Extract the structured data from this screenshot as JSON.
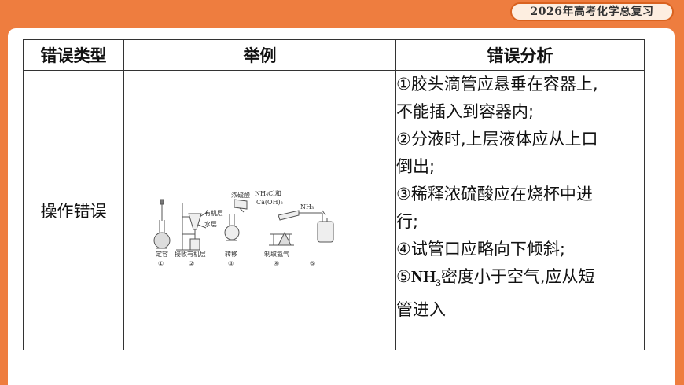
{
  "header": {
    "badge": "2026年高考化学总复习"
  },
  "table": {
    "headers": [
      "错误类型",
      "举例",
      "错误分析"
    ],
    "row": {
      "type": "操作错误",
      "figure": {
        "labels": {
          "flask_caption": "定容",
          "funnel_caption": "接收有机层",
          "organic_layer": "有机层",
          "water_layer": "水层",
          "acid_label": "浓硫酸",
          "transfer_caption": "转移",
          "reagent_label_1": "NH₄Cl和",
          "reagent_label_2": "Ca(OH)₂",
          "ammonia_caption": "制取氨气",
          "nh3_label": "NH₃"
        },
        "numbers": [
          "①",
          "②",
          "③",
          "④",
          "⑤"
        ]
      },
      "analysis": {
        "lines": [
          "①胶头滴管应悬垂在容器上,",
          "不能插入到容器内;",
          "②分液时,上层液体应从上口",
          "倒出;",
          "③稀释浓硫酸应在烧杯中进",
          "行;",
          "④试管口应略向下倾斜;"
        ],
        "line8": {
          "num": "⑤",
          "formula": "NH",
          "sub": "3",
          "rest": "密度小于空气,应从短"
        },
        "line9": "管进入"
      }
    }
  }
}
